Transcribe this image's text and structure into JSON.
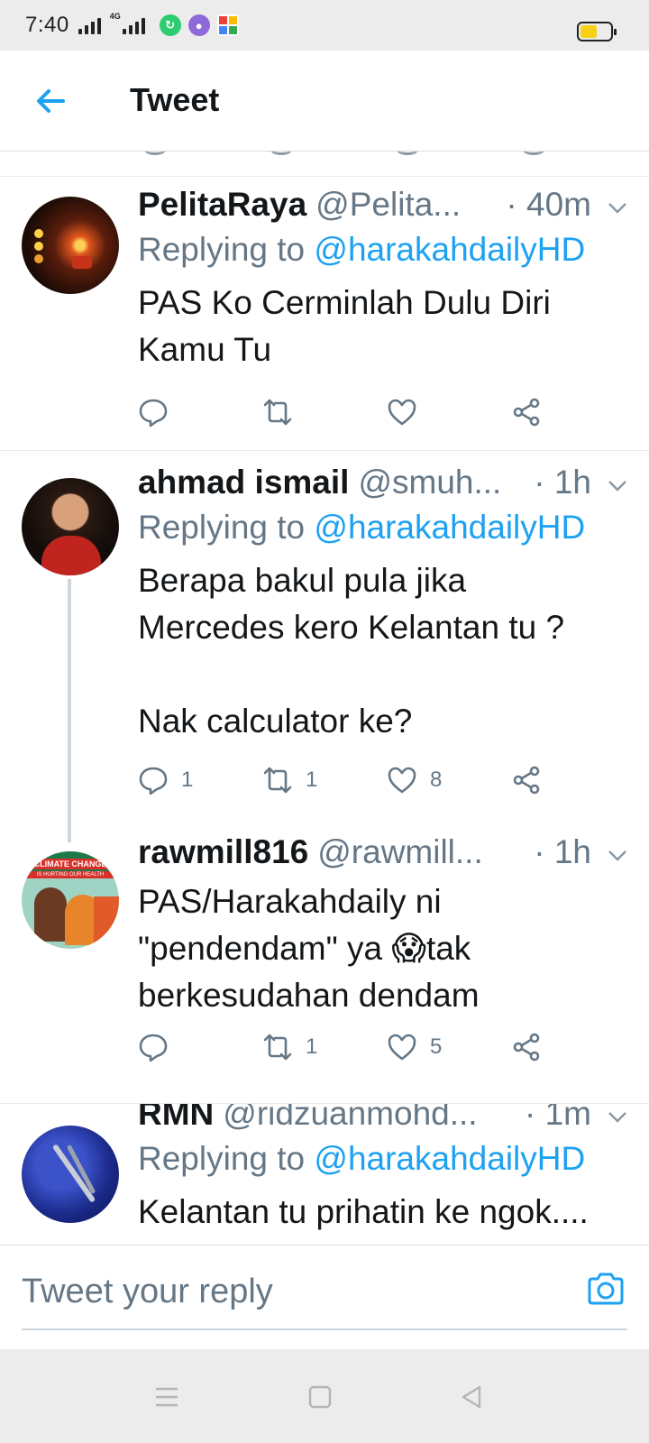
{
  "status_bar": {
    "time": "7:40",
    "network_label": "4G",
    "battery_color": "#f7d117"
  },
  "header": {
    "title": "Tweet",
    "back_icon": "arrow-left-icon"
  },
  "colors": {
    "accent": "#1da1f2",
    "secondary_text": "#657786"
  },
  "tweets": [
    {
      "display_name": "PelitaRaya",
      "handle": "@Pelita...",
      "time": "· 40m",
      "replying_prefix": "Replying to ",
      "replying_to": "@harakahdailyHD",
      "text": "PAS Ko Cerminlah Dulu Diri\nKamu Tu",
      "replies": "",
      "retweets": "",
      "likes": ""
    },
    {
      "display_name": "ahmad ismail",
      "handle": "@smuh...",
      "time": "· 1h",
      "replying_prefix": "Replying to ",
      "replying_to": "@harakahdailyHD",
      "text": "Berapa bakul pula jika\nMercedes kero Kelantan tu ?\n\nNak calculator ke?",
      "replies": "1",
      "retweets": "1",
      "likes": "8"
    },
    {
      "display_name": "rawmill816",
      "handle": "@rawmill...",
      "time": "· 1h",
      "text_before_emoji": "PAS/Harakahdaily ni\n\"pendendam\" ya ",
      "emoji": "😱",
      "text_after_emoji": "tak\nberkesudahan dendam",
      "avatar_text_top": "CLIMATE CHANGE",
      "avatar_text_bottom": "IS HURTING OUR HEALTH",
      "replies": "",
      "retweets": "1",
      "likes": "5"
    },
    {
      "display_name": "RMN",
      "handle": "@ridzuanmohd...",
      "time": "· 1m",
      "replying_prefix": "Replying to ",
      "replying_to": "@harakahdailyHD",
      "text": "Kelantan tu prihatin ke ngok...."
    }
  ],
  "reply_bar": {
    "placeholder": "Tweet your reply",
    "camera_icon": "camera-icon"
  },
  "nav_bar": {
    "icons": [
      "menu-icon",
      "home-square-icon",
      "back-triangle-icon"
    ]
  }
}
